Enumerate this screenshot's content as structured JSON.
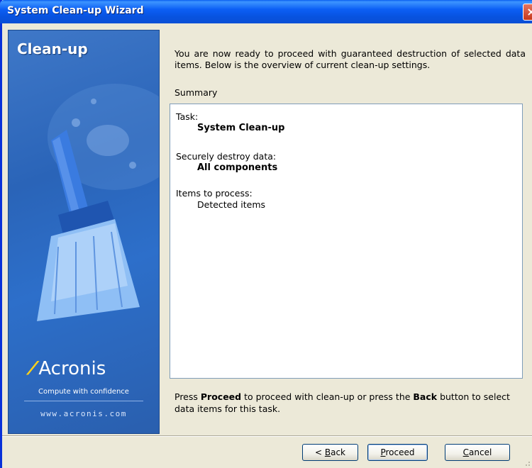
{
  "window": {
    "title": "System Clean-up Wizard",
    "close_label": "×"
  },
  "side_panel": {
    "title": "Clean-up",
    "brand_mark": "⁄",
    "brand_name": "Acronis",
    "tagline": "Compute with confidence",
    "url": "www.acronis.com"
  },
  "main": {
    "intro": "You are now ready to proceed with guaranteed destruction of selected data items. Below is the overview of current clean-up settings.",
    "summary_label": "Summary",
    "summary": [
      {
        "label": "Task:",
        "value": "System Clean-up",
        "bold": true
      },
      {
        "label": "Securely destroy data:",
        "value": "All components",
        "bold": true
      },
      {
        "label": "Items to process:",
        "value": "Detected items",
        "bold": false
      }
    ],
    "footer": {
      "part1": "Press ",
      "proceed_word": "Proceed",
      "part2": " to proceed with clean-up or press the ",
      "back_word": "Back",
      "part3": " button to select data items for this task."
    }
  },
  "buttons": {
    "back_prefix": "< ",
    "back_key": "B",
    "back_rest": "ack",
    "proceed_key": "P",
    "proceed_rest": "roceed",
    "cancel_key": "C",
    "cancel_rest": "ancel"
  },
  "colors": {
    "titlebar": "#0a5ff0",
    "side_panel": "#2d6fca",
    "window_bg": "#ece9d8",
    "close": "#c6381c"
  }
}
